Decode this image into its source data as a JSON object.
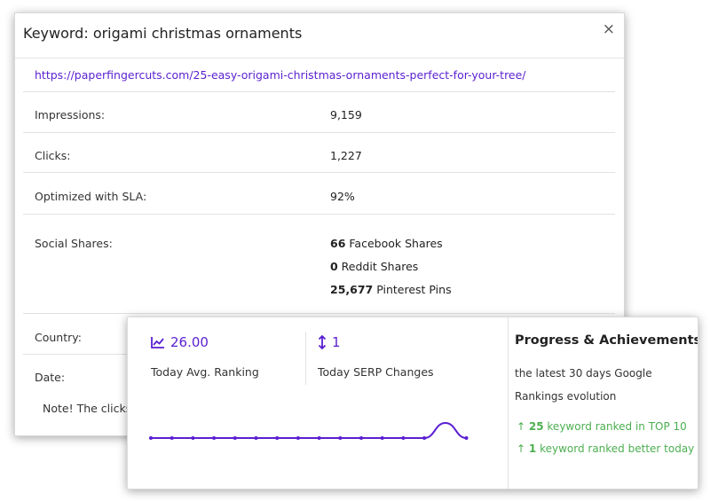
{
  "modal": {
    "title": "Keyword: origami christmas ornaments",
    "close_glyph": "×",
    "url": "https://paperfingercuts.com/25-easy-origami-christmas-ornaments-perfect-for-your-tree/",
    "rows": {
      "impressions": {
        "label": "Impressions:",
        "value": "9,159"
      },
      "clicks": {
        "label": "Clicks:",
        "value": "1,227"
      },
      "optimized": {
        "label": "Optimized with SLA:",
        "value": "92%"
      },
      "social": {
        "label": "Social Shares:",
        "facebook_count": "66",
        "facebook_label": " Facebook Shares",
        "reddit_count": "0",
        "reddit_label": " Reddit Shares",
        "pinterest_count": "25,677",
        "pinterest_label": " Pinterest Pins"
      },
      "country": {
        "label": "Country:"
      },
      "date": {
        "label": "Date:"
      }
    },
    "note": "Note! The clicks an"
  },
  "stats_card": {
    "avg_ranking": {
      "value": "26.00",
      "label": "Today Avg. Ranking",
      "icon": "line-chart-icon"
    },
    "serp_changes": {
      "value": "1",
      "label": "Today SERP Changes",
      "icon": "up-down-arrow-icon"
    },
    "progress": {
      "title": "Progress & Achievements",
      "description": "the latest 30 days Google Rankings evolution",
      "top10_count": "25",
      "top10_text": " keyword ranked in TOP 10",
      "better_count": "1",
      "better_text": " keyword ranked better today",
      "arrow_glyph": "↑"
    }
  },
  "colors": {
    "accent": "#5a1fd1",
    "success": "#4caf50"
  },
  "chart_data": {
    "type": "line",
    "series": [
      {
        "values": [
          0,
          0,
          0,
          0,
          0,
          0,
          0,
          0,
          0,
          0,
          0,
          0,
          0,
          0,
          1,
          0
        ]
      }
    ]
  }
}
